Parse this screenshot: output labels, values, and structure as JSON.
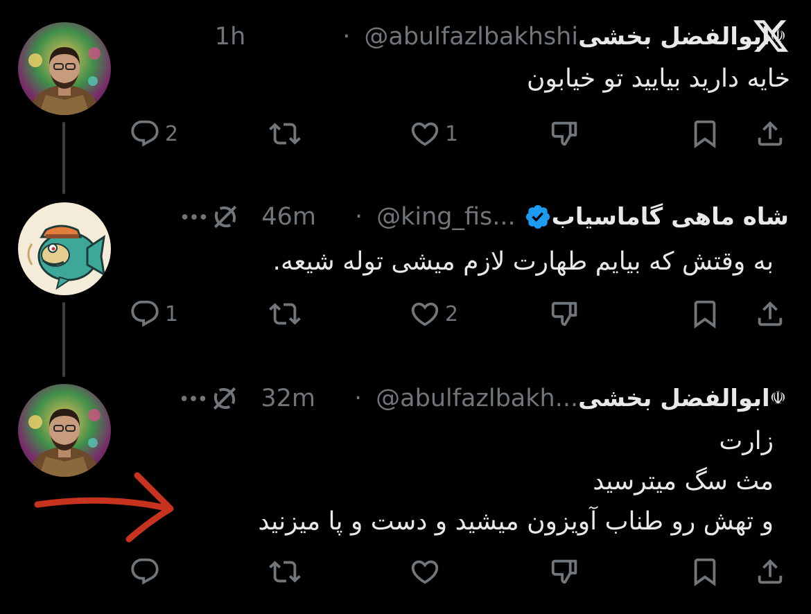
{
  "x_logo": "X",
  "tweets": [
    {
      "name": "ابوالفضل بخشی",
      "emblem": "☫",
      "handle": "@abulfazlbakhshi",
      "dot": "·",
      "time": "1h",
      "lines": [
        "خایه دارید بیایید تو خیابون"
      ],
      "reply_count": "2",
      "retweet_count": "",
      "like_count": "1"
    },
    {
      "name": "شاه ماهی گاماسیاب",
      "verified": true,
      "handle": "@king_fis...",
      "dot": "·",
      "time": "46m",
      "lines": [
        "به وقتش که بیایم طهارت لازم میشی توله شیعه."
      ],
      "reply_count": "1",
      "retweet_count": "",
      "like_count": "2"
    },
    {
      "name": "ابوالفضل بخشی",
      "emblem": "☫",
      "handle": "@abulfazlbakh...",
      "dot": "·",
      "time": "32m",
      "lines": [
        "زارت",
        "مث سگ میترسید",
        "و تهش رو طناب آویزون میشید و دست و پا میزنید"
      ],
      "reply_count": "",
      "retweet_count": "",
      "like_count": ""
    }
  ],
  "colors": {
    "background": "#000000",
    "text": "#e7e9ea",
    "muted": "#71767b",
    "verified": "#1d9bf0",
    "annotation_arrow": "#c8331f"
  }
}
